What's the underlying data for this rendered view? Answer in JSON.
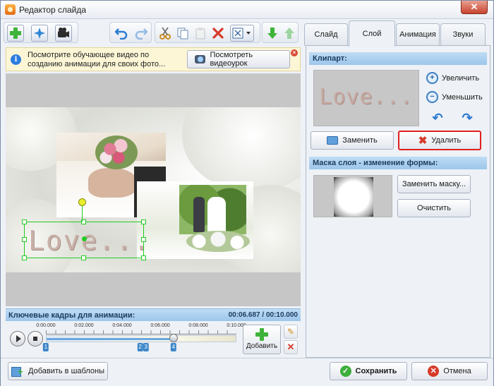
{
  "window": {
    "title": "Редактор слайда",
    "close_symbol": "✕"
  },
  "toolbar": {
    "icons": [
      "add-icon",
      "effects-icon",
      "camera-icon",
      "undo-icon",
      "redo-icon",
      "cut-icon",
      "copy-icon",
      "paste-icon",
      "delete-icon",
      "fit-icon",
      "move-down-icon",
      "move-up-icon"
    ]
  },
  "info": {
    "text": "Посмотрите обучающее видео по созданию анимации для своих фото...",
    "button_label": "Посмотреть видеоурок"
  },
  "canvas": {
    "overlay_text": "Love..."
  },
  "keyframes": {
    "title": "Ключевые кадры для анимации:",
    "time": "00:06.687 / 00:10.000",
    "tick_labels": [
      "0:00.000",
      "0:02.000",
      "0:04.000",
      "0:06.000",
      "0:08.000",
      "0:10.000"
    ],
    "playhead_fraction": 0.67,
    "markers": [
      {
        "label": "1",
        "fraction": 0.0
      },
      {
        "label": "2",
        "fraction": 0.495
      },
      {
        "label": "3",
        "fraction": 0.525
      },
      {
        "label": "4",
        "fraction": 0.67
      }
    ],
    "add_label": "Добавить"
  },
  "tabs": [
    {
      "label": "Слайд",
      "active": false
    },
    {
      "label": "Слой",
      "active": true
    },
    {
      "label": "Анимация",
      "active": false
    },
    {
      "label": "Звуки",
      "active": false
    }
  ],
  "clipart": {
    "header": "Клипарт:",
    "preview_text": "Love...",
    "zoom_in_label": "Увеличить",
    "zoom_out_label": "Уменьшить",
    "replace_label": "Заменить",
    "delete_label": "Удалить"
  },
  "mask": {
    "header": "Маска слоя - изменение формы:",
    "replace_label": "Заменить маску...",
    "clear_label": "Очистить"
  },
  "footer": {
    "template_label": "Добавить в шаблоны",
    "save_label": "Сохранить",
    "cancel_label": "Отмена"
  },
  "colors": {
    "accent_blue": "#9cc6ea",
    "delete_highlight": "#e02020",
    "selection_green": "#22cc22"
  }
}
